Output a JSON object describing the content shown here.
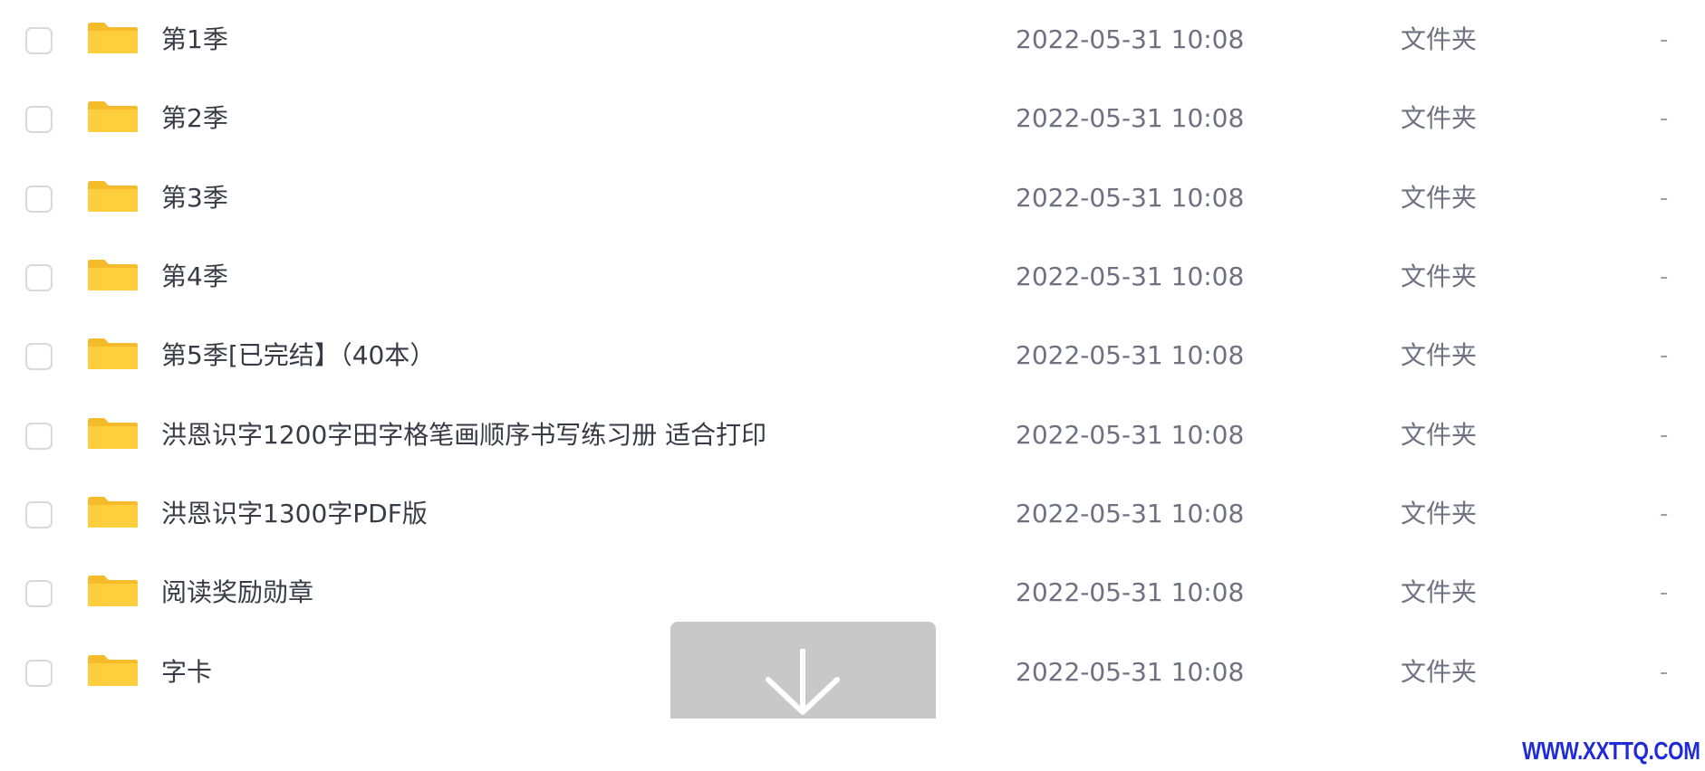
{
  "colors": {
    "folder": "#FFCE3D",
    "folder_tab": "#F6BB2A",
    "watermark": "#1F2BD6",
    "download_bg": "#C8C8C8"
  },
  "files": [
    {
      "name": "第1季",
      "date": "2022-05-31 10:08",
      "type": "文件夹",
      "size": "-"
    },
    {
      "name": "第2季",
      "date": "2022-05-31 10:08",
      "type": "文件夹",
      "size": "-"
    },
    {
      "name": "第3季",
      "date": "2022-05-31 10:08",
      "type": "文件夹",
      "size": "-"
    },
    {
      "name": "第4季",
      "date": "2022-05-31 10:08",
      "type": "文件夹",
      "size": "-"
    },
    {
      "name": "第5季[已完结】（40本）",
      "date": "2022-05-31 10:08",
      "type": "文件夹",
      "size": "-"
    },
    {
      "name": "洪恩识字1200字田字格笔画顺序书写练习册 适合打印",
      "date": "2022-05-31 10:08",
      "type": "文件夹",
      "size": "-"
    },
    {
      "name": "洪恩识字1300字PDF版",
      "date": "2022-05-31 10:08",
      "type": "文件夹",
      "size": "-"
    },
    {
      "name": "阅读奖励勋章",
      "date": "2022-05-31 10:08",
      "type": "文件夹",
      "size": "-"
    },
    {
      "name": "字卡",
      "date": "2022-05-31 10:08",
      "type": "文件夹",
      "size": "-"
    }
  ],
  "download_icon": "arrow-down-icon",
  "folder_icon": "folder-icon",
  "watermark": "WWW.XXTTQ.COM"
}
